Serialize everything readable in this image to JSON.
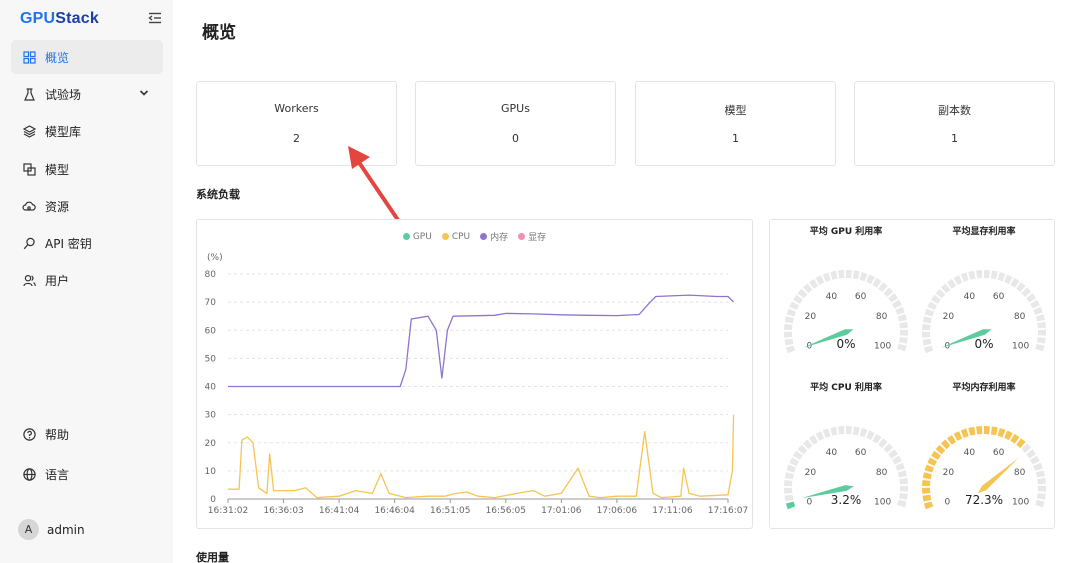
{
  "app": {
    "logo_part1": "GPU",
    "logo_part2": "Stack"
  },
  "sidebar": {
    "items": [
      {
        "label": "概览",
        "icon": "dashboard-icon"
      },
      {
        "label": "试验场",
        "icon": "flask-icon"
      },
      {
        "label": "模型库",
        "icon": "layers-icon"
      },
      {
        "label": "模型",
        "icon": "model-icon"
      },
      {
        "label": "资源",
        "icon": "cloud-icon"
      },
      {
        "label": "API 密钥",
        "icon": "key-icon"
      },
      {
        "label": "用户",
        "icon": "users-icon"
      }
    ],
    "bottom": [
      {
        "label": "帮助",
        "icon": "help-icon"
      },
      {
        "label": "语言",
        "icon": "globe-icon"
      }
    ],
    "user": {
      "initial": "A",
      "name": "admin"
    }
  },
  "page": {
    "title": "概览"
  },
  "stats": [
    {
      "label": "Workers",
      "value": "2"
    },
    {
      "label": "GPUs",
      "value": "0"
    },
    {
      "label": "模型",
      "value": "1"
    },
    {
      "label": "副本数",
      "value": "1"
    }
  ],
  "sections": {
    "system_load": "系统负载",
    "usage": "使用量"
  },
  "colors": {
    "accent": "#1e74e8",
    "gpu": "#5ccc9f",
    "cpu": "#f6c453",
    "memory": "#8e74d0",
    "vram": "#f28fb0",
    "arrow": "#e5453f"
  },
  "chart_data": [
    {
      "type": "line",
      "ylabel": "(%)",
      "ylim": [
        0,
        80
      ],
      "yticks": [
        0,
        10,
        20,
        30,
        40,
        50,
        60,
        70,
        80
      ],
      "x_ticks": [
        "16:31:02",
        "16:36:03",
        "16:41:04",
        "16:46:04",
        "16:51:05",
        "16:56:05",
        "17:01:06",
        "17:06:06",
        "17:11:06",
        "17:16:07"
      ],
      "legend": [
        "GPU",
        "CPU",
        "内存",
        "显存"
      ],
      "legend_position": "top-center",
      "series": [
        {
          "name": "内存",
          "points": [
            [
              0,
              40
            ],
            [
              1,
              40
            ],
            [
              2,
              40
            ],
            [
              3,
              40
            ],
            [
              3.1,
              40
            ],
            [
              3.2,
              46
            ],
            [
              3.3,
              64
            ],
            [
              3.6,
              65
            ],
            [
              3.75,
              60
            ],
            [
              3.85,
              43
            ],
            [
              3.95,
              60
            ],
            [
              4.05,
              65
            ],
            [
              4.8,
              65.3
            ],
            [
              5.0,
              66
            ],
            [
              5.5,
              65.8
            ],
            [
              6,
              65.5
            ],
            [
              6.5,
              65.3
            ],
            [
              7,
              65.2
            ],
            [
              7.4,
              65.6
            ],
            [
              7.6,
              70
            ],
            [
              7.7,
              72
            ],
            [
              8.3,
              72.5
            ],
            [
              8.8,
              72
            ],
            [
              9,
              72
            ],
            [
              9.1,
              70
            ]
          ]
        },
        {
          "name": "CPU",
          "points": [
            [
              0,
              3.5
            ],
            [
              0.2,
              3.5
            ],
            [
              0.25,
              21
            ],
            [
              0.35,
              22
            ],
            [
              0.45,
              20
            ],
            [
              0.55,
              4
            ],
            [
              0.7,
              2
            ],
            [
              0.75,
              16
            ],
            [
              0.82,
              3
            ],
            [
              1,
              3
            ],
            [
              1.2,
              3
            ],
            [
              1.4,
              4
            ],
            [
              1.6,
              0.5
            ],
            [
              2,
              1
            ],
            [
              2.3,
              3
            ],
            [
              2.6,
              2
            ],
            [
              2.75,
              9
            ],
            [
              2.9,
              2
            ],
            [
              3.2,
              0.5
            ],
            [
              3.6,
              1
            ],
            [
              3.9,
              1
            ],
            [
              4.1,
              2
            ],
            [
              4.3,
              2.5
            ],
            [
              4.5,
              1
            ],
            [
              4.8,
              0.5
            ],
            [
              5.2,
              2
            ],
            [
              5.5,
              3
            ],
            [
              5.7,
              1
            ],
            [
              6,
              2
            ],
            [
              6.3,
              11
            ],
            [
              6.5,
              1
            ],
            [
              6.7,
              0.5
            ],
            [
              7,
              1
            ],
            [
              7.35,
              1
            ],
            [
              7.5,
              24
            ],
            [
              7.65,
              2
            ],
            [
              7.8,
              0.5
            ],
            [
              8.15,
              1
            ],
            [
              8.2,
              11
            ],
            [
              8.3,
              2
            ],
            [
              8.5,
              1
            ],
            [
              9,
              1.5
            ],
            [
              9.08,
              10
            ],
            [
              9.1,
              30
            ]
          ]
        },
        {
          "name": "GPU",
          "points": []
        },
        {
          "name": "显存",
          "points": []
        }
      ]
    },
    {
      "type": "gauge",
      "gauges": [
        {
          "title": "平均 GPU 利用率",
          "value": 0,
          "display": "0%",
          "min": 0,
          "max": 100,
          "ticks": [
            "0",
            "20",
            "40",
            "60",
            "80",
            "100"
          ],
          "color": "#5ccc9f"
        },
        {
          "title": "平均显存利用率",
          "value": 0,
          "display": "0%",
          "min": 0,
          "max": 100,
          "ticks": [
            "0",
            "20",
            "40",
            "60",
            "80",
            "100"
          ],
          "color": "#5ccc9f"
        },
        {
          "title": "平均 CPU 利用率",
          "value": 3.2,
          "display": "3.2%",
          "min": 0,
          "max": 100,
          "ticks": [
            "0",
            "20",
            "40",
            "60",
            "80",
            "100"
          ],
          "color": "#5ccc9f"
        },
        {
          "title": "平均内存利用率",
          "value": 72.3,
          "display": "72.3%",
          "min": 0,
          "max": 100,
          "ticks": [
            "0",
            "20",
            "40",
            "60",
            "80",
            "100"
          ],
          "color": "#f6c453"
        }
      ]
    }
  ]
}
